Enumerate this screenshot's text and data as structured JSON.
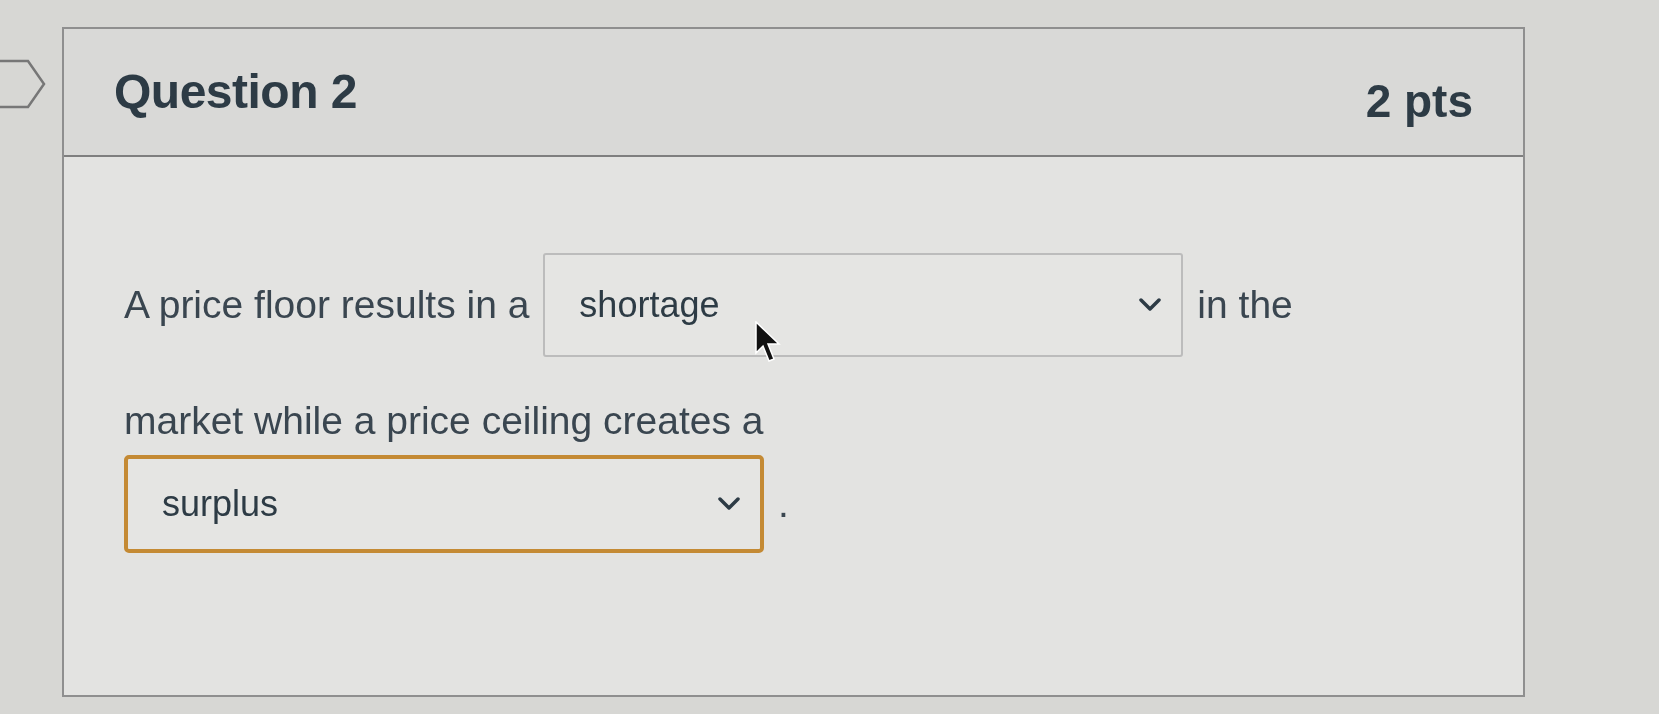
{
  "question": {
    "title": "Question 2",
    "points": "2 pts"
  },
  "lines": [
    {
      "parts": [
        {
          "kind": "text",
          "text": "A price floor results in a"
        },
        {
          "kind": "dropdown",
          "value": "shortage",
          "focused": false,
          "hovered": true
        },
        {
          "kind": "text",
          "text": "in the"
        }
      ]
    },
    {
      "parts": [
        {
          "kind": "text",
          "text": "market while a price ceiling creates a"
        }
      ]
    },
    {
      "parts": [
        {
          "kind": "dropdown",
          "value": "surplus",
          "focused": true,
          "hovered": false
        },
        {
          "kind": "text",
          "text": "."
        }
      ]
    }
  ]
}
